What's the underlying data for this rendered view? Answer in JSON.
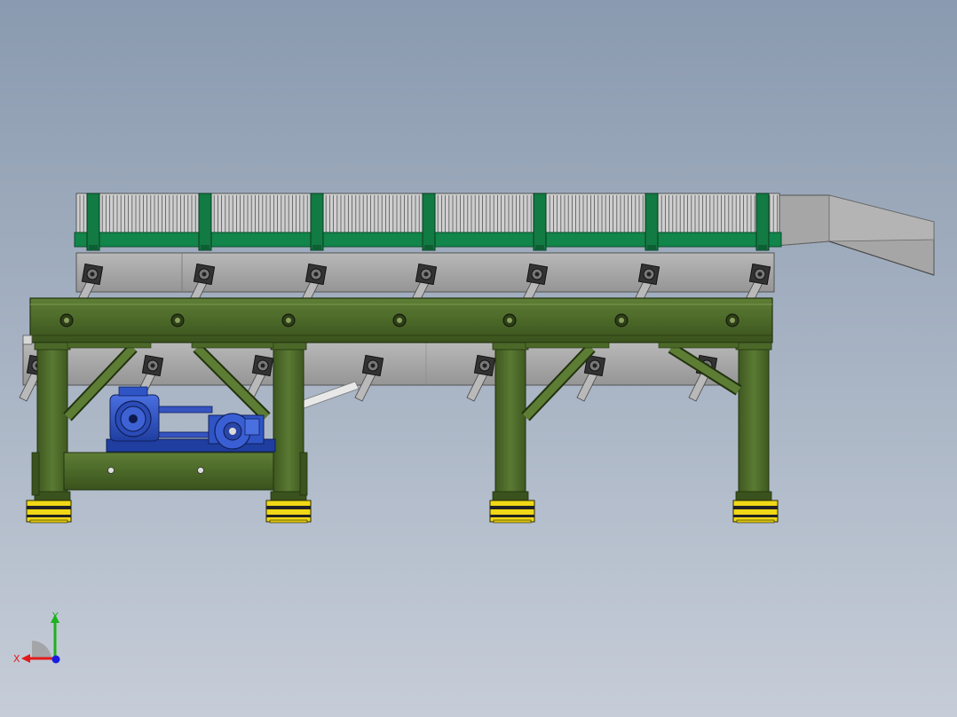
{
  "triad": {
    "x_label": "X",
    "y_label": "Y",
    "x_color": "#e21a1a",
    "y_color": "#1cb31c",
    "z_color": "#1a1ae2"
  },
  "model": {
    "view": "front",
    "colors": {
      "frame": "#4e6b2a",
      "frame_dark": "#2f4417",
      "frame_light": "#6d8c43",
      "teeth_band": "#11854a",
      "teeth": "#c9c9c9",
      "housing": "#a8a8a8",
      "chute": "#a4a4a4",
      "motor": "#2f54c6",
      "foot_pad": "#f0d816",
      "mount": "#b9b9b9"
    },
    "icons": [
      "electric-motor-icon",
      "bearing-block-icon",
      "leveling-foot-icon"
    ]
  }
}
